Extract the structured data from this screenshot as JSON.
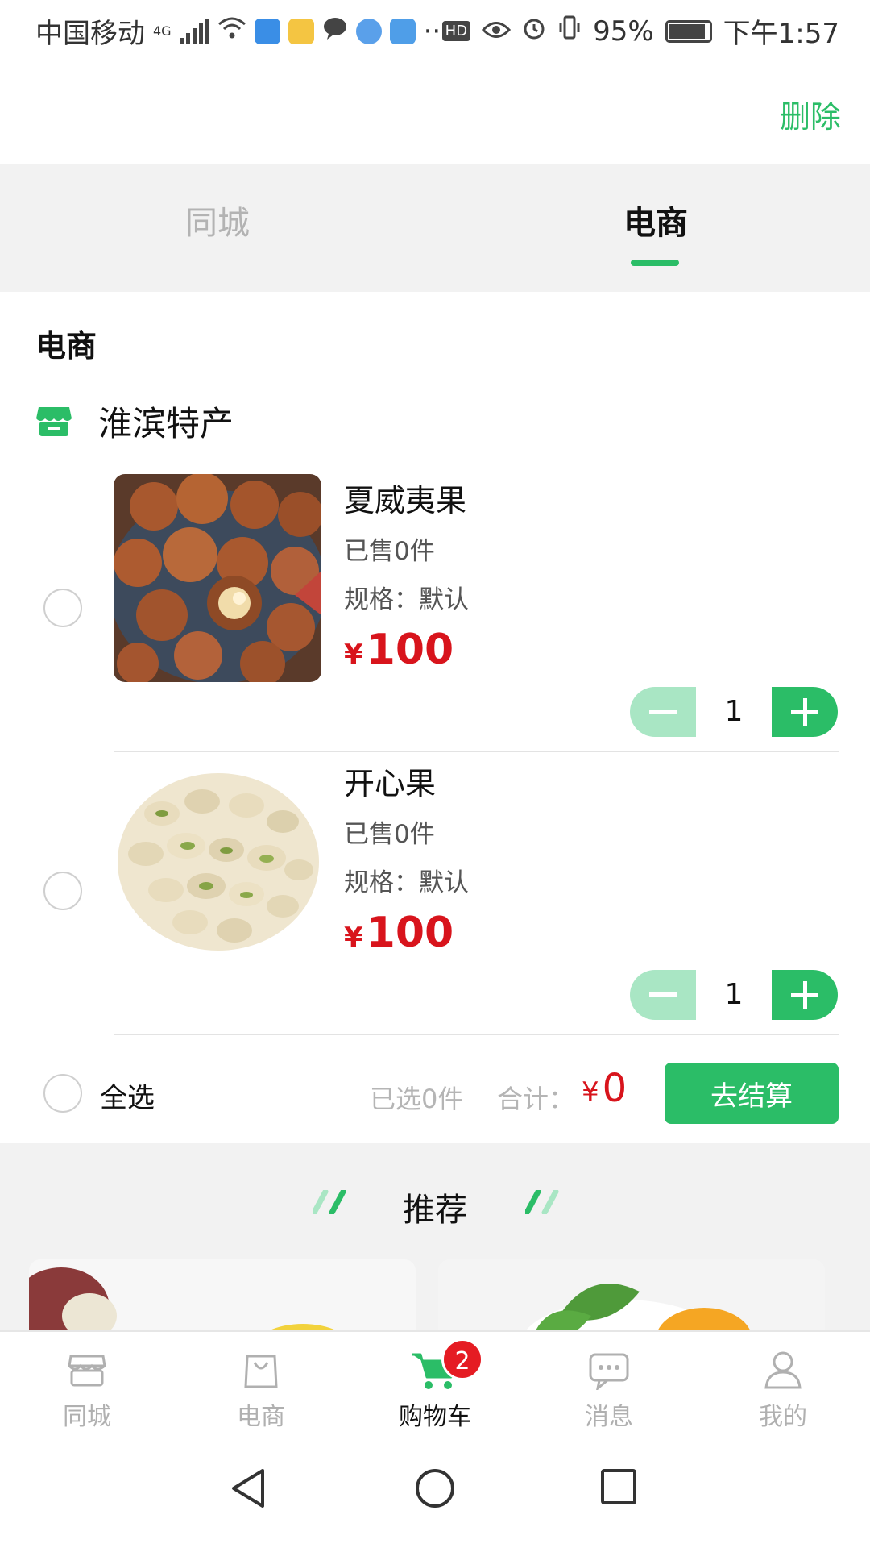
{
  "status_bar": {
    "carrier": "中国移动",
    "network": "4G",
    "battery": "95%",
    "time": "下午1:57"
  },
  "header": {
    "delete_label": "删除"
  },
  "tabs": [
    {
      "label": "同城",
      "active": false
    },
    {
      "label": "电商",
      "active": true
    }
  ],
  "section_title": "电商",
  "store": {
    "name": "淮滨特产",
    "icon": "shop-icon"
  },
  "cart_items": [
    {
      "name": "夏威夷果",
      "sold": "已售0件",
      "spec": "规格：默认",
      "currency": "¥",
      "price": "100",
      "quantity": "1",
      "image": "macadamia-nuts"
    },
    {
      "name": "开心果",
      "sold": "已售0件",
      "spec": "规格：默认",
      "currency": "¥",
      "price": "100",
      "quantity": "1",
      "image": "pistachios"
    }
  ],
  "checkout_bar": {
    "select_all_label": "全选",
    "selected_count": "已选0件",
    "total_label": "合计：",
    "total_currency": "¥",
    "total_value": "0",
    "checkout_label": "去结算"
  },
  "recommend": {
    "title": "推荐"
  },
  "bottom_nav": [
    {
      "label": "同城",
      "icon": "store-icon",
      "active": false
    },
    {
      "label": "电商",
      "icon": "shopping-bag-icon",
      "active": false
    },
    {
      "label": "购物车",
      "icon": "cart-icon",
      "active": true,
      "badge": "2"
    },
    {
      "label": "消息",
      "icon": "message-icon",
      "active": false
    },
    {
      "label": "我的",
      "icon": "user-icon",
      "active": false
    }
  ],
  "colors": {
    "accent": "#2bbd67",
    "price": "#d8141c",
    "badge": "#e51c23"
  }
}
